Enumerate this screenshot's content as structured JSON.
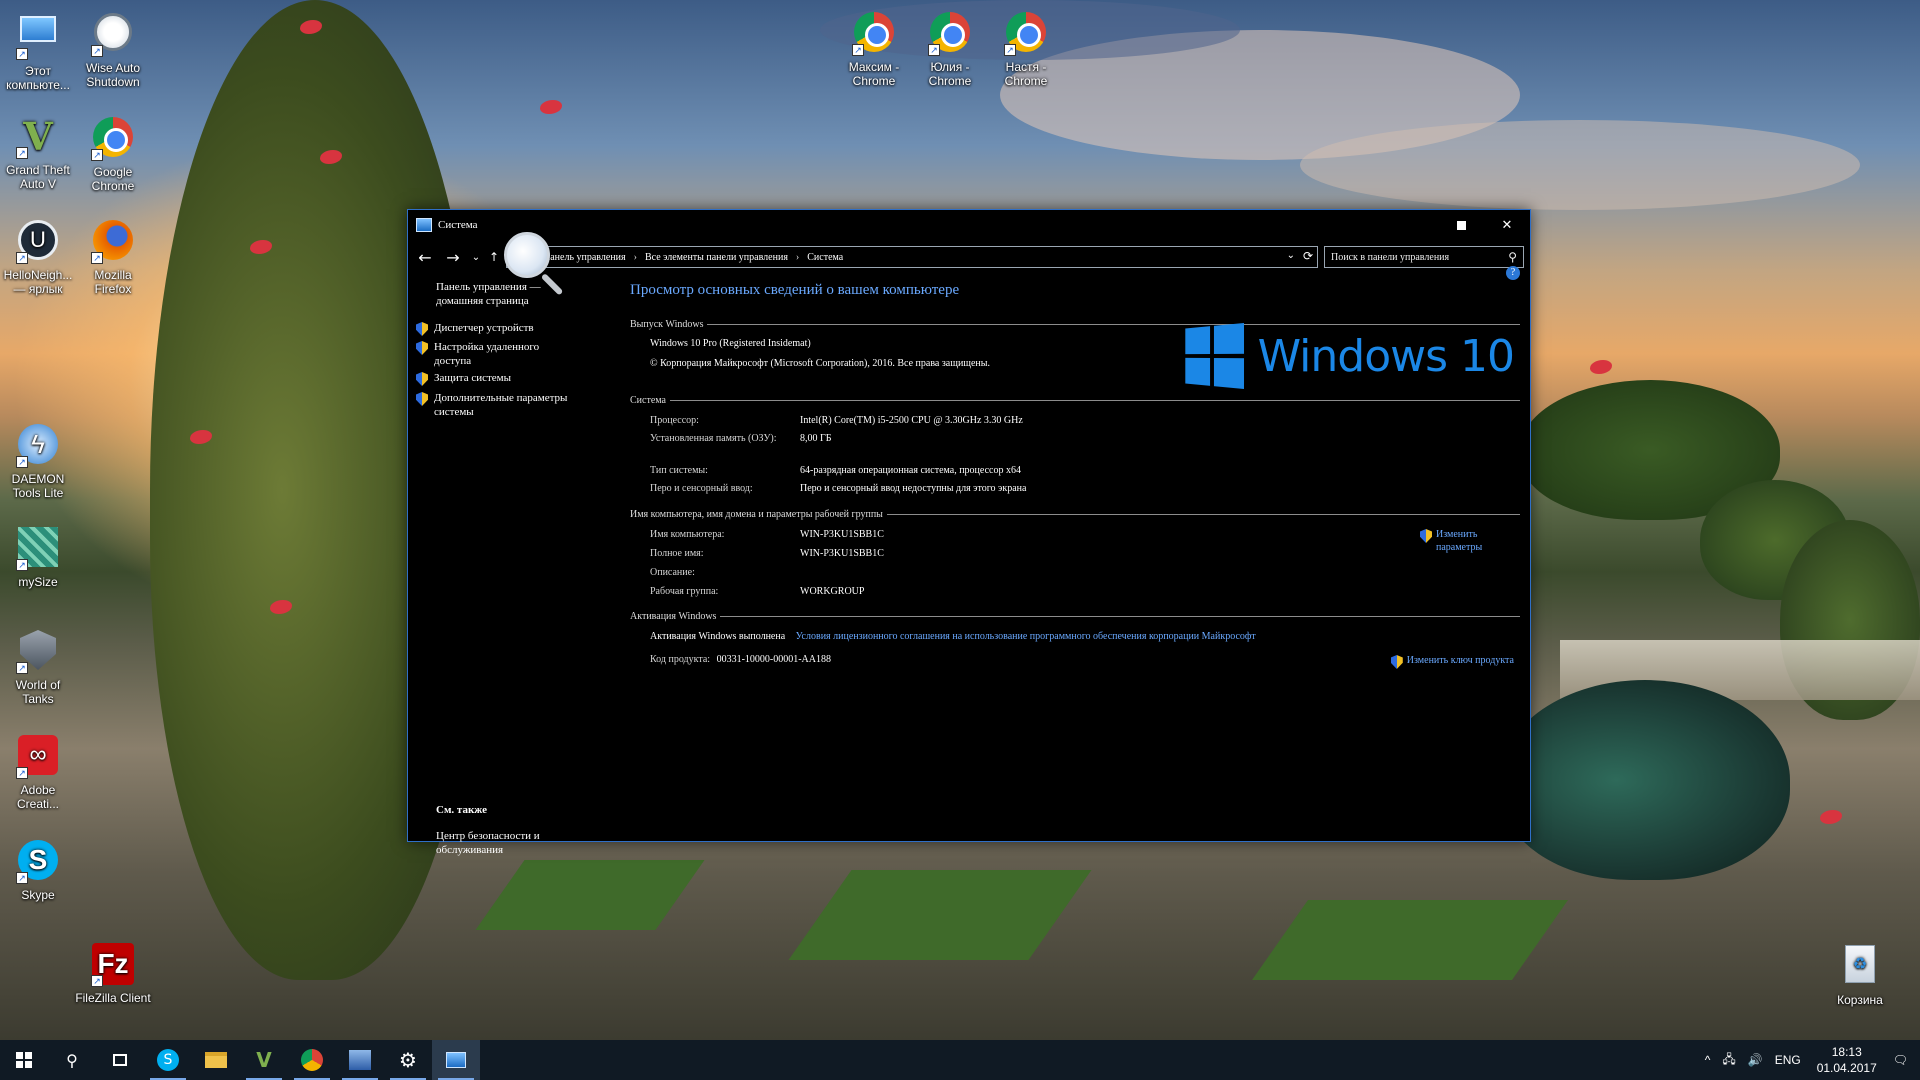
{
  "desktop": {
    "icons": [
      {
        "label": "Этот компьюте...",
        "icon": "this-pc-icon"
      },
      {
        "label": "Wise Auto Shutdown",
        "icon": "wise-auto-shutdown-icon"
      },
      {
        "label": "Grand Theft Auto V",
        "icon": "gta-v-icon"
      },
      {
        "label": "Google Chrome",
        "icon": "chrome-icon"
      },
      {
        "label": "HelloNeigh... — ярлык",
        "icon": "unreal-icon"
      },
      {
        "label": "Mozilla Firefox",
        "icon": "firefox-icon"
      },
      {
        "label": "DAEMON Tools Lite",
        "icon": "daemon-tools-icon"
      },
      {
        "label": "mySize",
        "icon": "mysize-icon"
      },
      {
        "label": "World of Tanks",
        "icon": "world-of-tanks-icon"
      },
      {
        "label": "Adobe Creati...",
        "icon": "adobe-cc-icon"
      },
      {
        "label": "Skype",
        "icon": "skype-icon"
      },
      {
        "label": "FileZilla Client",
        "icon": "filezilla-icon"
      },
      {
        "label": "Максим - Chrome",
        "icon": "chrome-profile-icon"
      },
      {
        "label": "Юлия - Chrome",
        "icon": "chrome-profile-icon"
      },
      {
        "label": "Настя - Chrome",
        "icon": "chrome-profile-icon"
      },
      {
        "label": "Корзина",
        "icon": "recycle-bin-icon"
      }
    ]
  },
  "window": {
    "title": "Система",
    "breadcrumb": [
      "Панель управления",
      "Все элементы панели управления",
      "Система"
    ],
    "search_placeholder": "Поиск в панели управления",
    "left_home": "Панель управления — домашняя страница",
    "left_links": [
      "Диспетчер устройств",
      "Настройка удаленного доступа",
      "Защита системы",
      "Дополнительные параметры системы"
    ],
    "see_also": "См. также",
    "security_link": "Центр безопасности и обслуживания",
    "heading": "Просмотр основных сведений о вашем компьютере",
    "edition": {
      "section": "Выпуск Windows",
      "name": "Windows 10 Pro (Registered Insidemat)",
      "copyright": "© Корпорация Майкрософт (Microsoft Corporation), 2016. Все права защищены.",
      "logo_text": "Windows 10"
    },
    "system": {
      "section": "Система",
      "rows": [
        {
          "k": "Процессор:",
          "v": "Intel(R) Core(TM) i5-2500 CPU @ 3.30GHz 3.30 GHz"
        },
        {
          "k": "Установленная память (ОЗУ):",
          "v": "8,00 ГБ"
        },
        {
          "k": "Тип системы:",
          "v": "64-разрядная операционная система, процессор x64"
        },
        {
          "k": "Перо и сенсорный ввод:",
          "v": "Перо и сенсорный ввод недоступны для этого экрана"
        }
      ]
    },
    "computer": {
      "section": "Имя компьютера, имя домена и параметры рабочей группы",
      "rows": [
        {
          "k": "Имя компьютера:",
          "v": "WIN-P3KU1SBB1C"
        },
        {
          "k": "Полное имя:",
          "v": "WIN-P3KU1SBB1C"
        },
        {
          "k": "Описание:",
          "v": ""
        },
        {
          "k": "Рабочая группа:",
          "v": "WORKGROUP"
        }
      ],
      "change_link": "Изменить параметры"
    },
    "activation": {
      "section": "Активация Windows",
      "status_label": "Активация Windows выполнена",
      "terms_link": "Условия лицензионного соглашения на использование программного обеспечения корпорации Майкрософт",
      "product_label": "Код продукта:",
      "product_id": "00331-10000-00001-AA188",
      "change_key_link": "Изменить ключ продукта"
    }
  },
  "taskbar": {
    "language": "ENG",
    "time": "18:13",
    "date": "01.04.2017"
  }
}
